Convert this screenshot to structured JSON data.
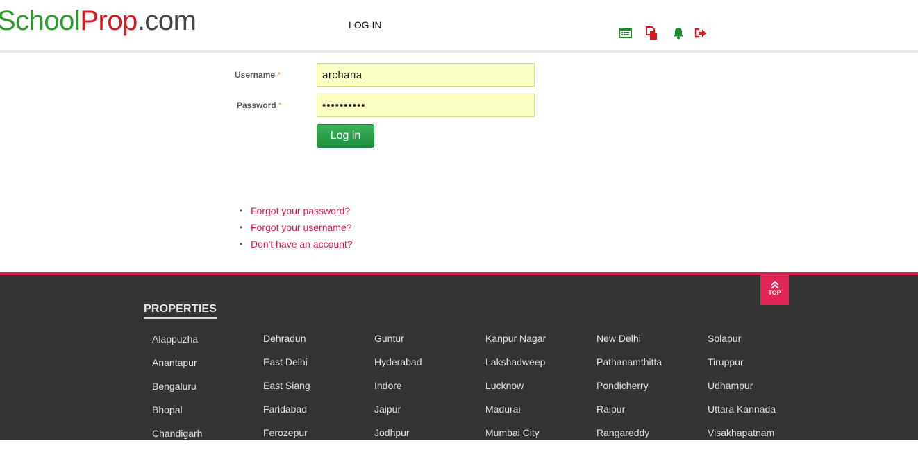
{
  "header": {
    "logo": {
      "part1": "School",
      "part2": "Prop",
      "part3": ".com"
    },
    "nav_login": "LOG IN",
    "icons": [
      "list-icon",
      "documents-icon",
      "bell-icon",
      "logout-icon"
    ]
  },
  "form": {
    "username_label": "Username",
    "password_label": "Password",
    "required_mark": "*",
    "username_value": "archana",
    "password_value": "••••••••••",
    "login_button": "Log in"
  },
  "links": {
    "forgot_password": "Forgot your password?",
    "forgot_username": "Forgot your username?",
    "no_account": "Don't have an account?"
  },
  "footer": {
    "title": "PROPERTIES",
    "top_label": "TOP",
    "columns": [
      [
        "Alappuzha",
        "Anantapur",
        "Bengaluru",
        "Bhopal",
        "Chandigarh"
      ],
      [
        "Dehradun",
        "East Delhi",
        "East Siang",
        "Faridabad",
        "Ferozepur"
      ],
      [
        "Guntur",
        "Hyderabad",
        "Indore",
        "Jaipur",
        "Jodhpur"
      ],
      [
        "Kanpur Nagar",
        "Lakshadweep",
        "Lucknow",
        "Madurai",
        "Mumbai City"
      ],
      [
        "New Delhi",
        "Pathanamthitta",
        "Pondicherry",
        "Raipur",
        "Rangareddy"
      ],
      [
        "Solapur",
        "Tiruppur",
        "Udhampur",
        "Uttara Kannada",
        "Visakhapatnam"
      ]
    ]
  },
  "colors": {
    "accent": "#d6204e",
    "button_green": "#2aa04a",
    "footer_bg": "#333333",
    "field_bg": "#fbffc2"
  }
}
